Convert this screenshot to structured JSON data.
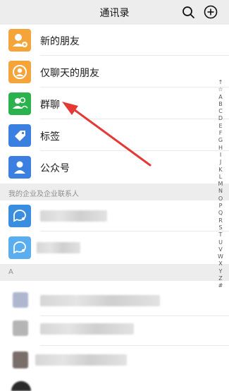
{
  "header": {
    "title": "通讯录"
  },
  "icons": {
    "search": "search-icon",
    "add": "add-circle-icon"
  },
  "rows": [
    {
      "label": "新的朋友",
      "icon": "add-friend-icon",
      "color": "#f5a43a"
    },
    {
      "label": "仅聊天的朋友",
      "icon": "chat-friend-icon",
      "color": "#f5a43a"
    },
    {
      "label": "群聊",
      "icon": "group-chat-icon",
      "color": "#2bb24c"
    },
    {
      "label": "标签",
      "icon": "tag-icon",
      "color": "#3b7fe0"
    },
    {
      "label": "公众号",
      "icon": "official-account-icon",
      "color": "#3b7fe0"
    }
  ],
  "sections": {
    "enterprise": "我的企业及企业联系人",
    "letter_a": "A"
  },
  "index_letters": [
    "↑",
    "☆",
    "A",
    "B",
    "C",
    "D",
    "E",
    "F",
    "G",
    "H",
    "I",
    "J",
    "K",
    "L",
    "M",
    "N",
    "O",
    "P",
    "Q",
    "R",
    "S",
    "T",
    "U",
    "V",
    "W",
    "X",
    "Y",
    "Z",
    "#"
  ],
  "colors": {
    "annotation_arrow": "#e53935",
    "header_bg": "#ededed"
  }
}
